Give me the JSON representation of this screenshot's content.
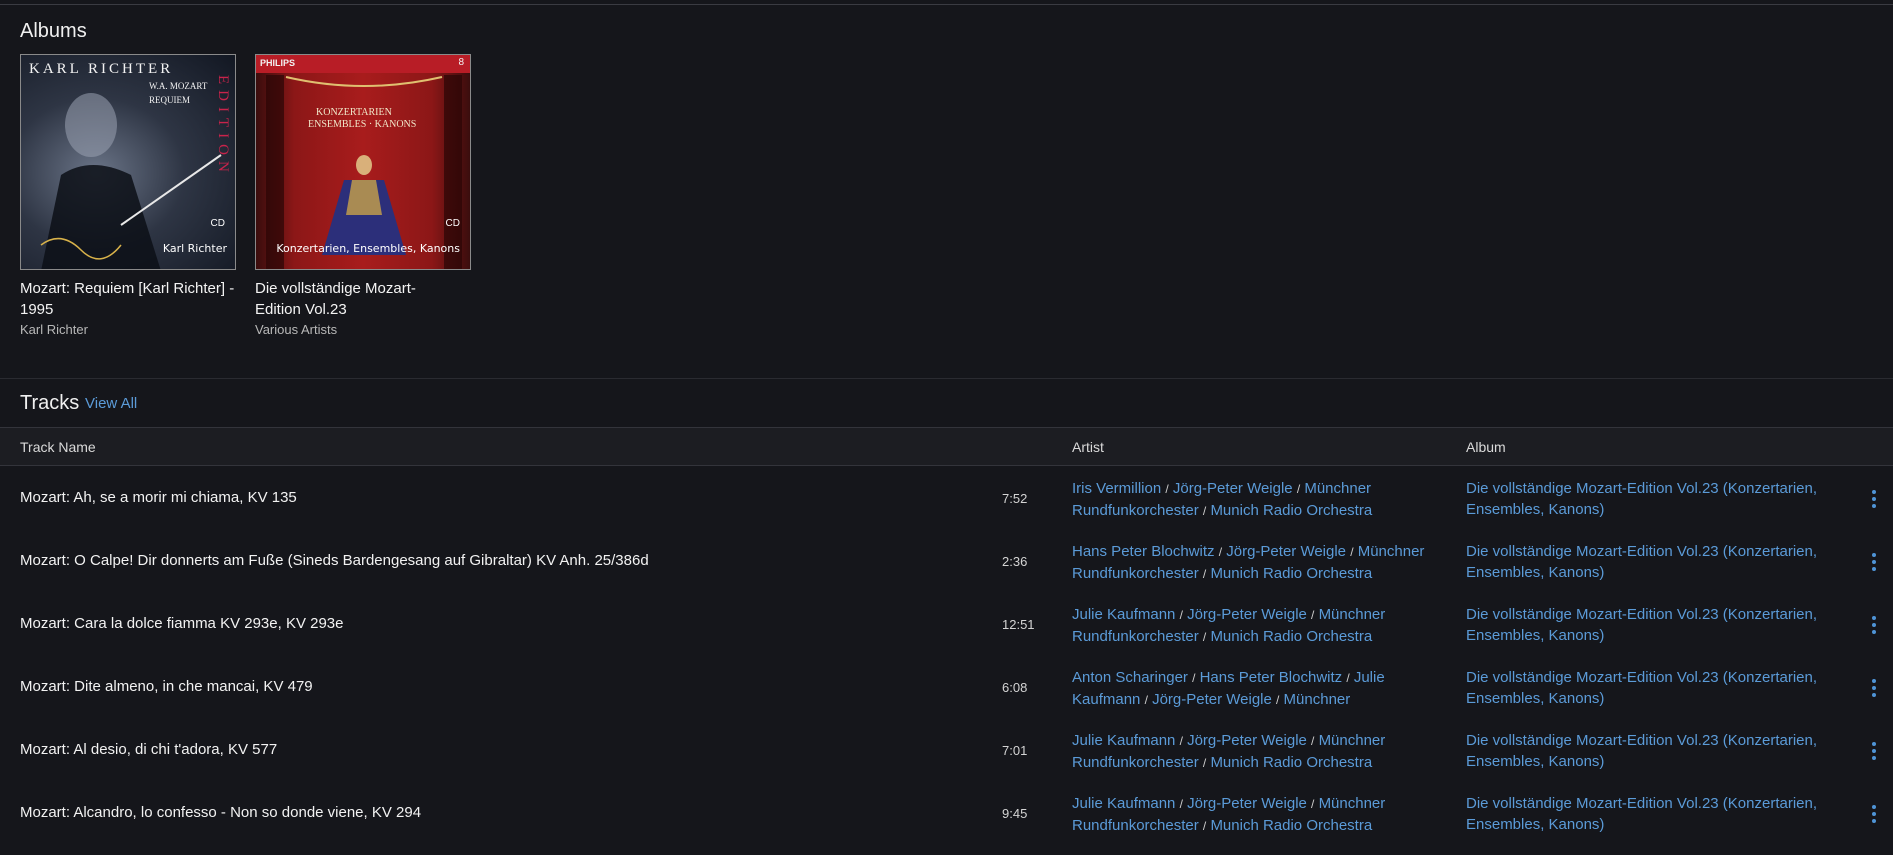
{
  "albums_section": {
    "title": "Albums",
    "items": [
      {
        "name": "Mozart: Requiem [Karl Richter] - 1995",
        "artist": "Karl Richter",
        "cover": {
          "line1": "KARL RICHTER",
          "line2": "W.A. MOZART",
          "line3": "REQUIEM",
          "side": "EDITION",
          "badge": "CD",
          "caption": "Karl Richter"
        }
      },
      {
        "name": "Die vollständige Mozart-Edition Vol.23",
        "artist": "Various Artists",
        "cover": {
          "label": "PHILIPS",
          "number": "8",
          "title1": "KONZERTARIEN",
          "title2": "ENSEMBLES · KANONS",
          "badge": "CD",
          "caption": "Konzertarien, Ensembles, Kanons"
        }
      }
    ]
  },
  "tracks_section": {
    "title": "Tracks",
    "view_all": "View All",
    "columns": {
      "track": "Track Name",
      "artist": "Artist",
      "album": "Album"
    },
    "separator": "/",
    "rows": [
      {
        "track": "Mozart: Ah, se a morir mi chiama, KV 135",
        "duration": "7:52",
        "artists": [
          "Iris Vermillion",
          "Jörg-Peter Weigle",
          "Münchner Rundfunkorchester",
          "Munich Radio Orchestra"
        ],
        "album": "Die vollständige Mozart-Edition Vol.23 (Konzertarien, Ensembles, Kanons)"
      },
      {
        "track": "Mozart: O Calpe! Dir donnerts am Fuße (Sineds Bardengesang auf Gibraltar) KV Anh. 25/386d",
        "duration": "2:36",
        "artists": [
          "Hans Peter Blochwitz",
          "Jörg-Peter Weigle",
          "Münchner Rundfunkorchester",
          "Munich Radio Orchestra"
        ],
        "album": "Die vollständige Mozart-Edition Vol.23 (Konzertarien, Ensembles, Kanons)"
      },
      {
        "track": "Mozart: Cara la dolce fiamma KV 293e, KV 293e",
        "duration": "12:51",
        "artists": [
          "Julie Kaufmann",
          "Jörg-Peter Weigle",
          "Münchner Rundfunkorchester",
          "Munich Radio Orchestra"
        ],
        "album": "Die vollständige Mozart-Edition Vol.23 (Konzertarien, Ensembles, Kanons)"
      },
      {
        "track": "Mozart: Dite almeno, in che mancai, KV 479",
        "duration": "6:08",
        "artists": [
          "Anton Scharinger",
          "Hans Peter Blochwitz",
          "Julie Kaufmann",
          "Jörg-Peter Weigle",
          "Münchner"
        ],
        "album": "Die vollständige Mozart-Edition Vol.23 (Konzertarien, Ensembles, Kanons)"
      },
      {
        "track": "Mozart: Al desio, di chi t'adora, KV 577",
        "duration": "7:01",
        "artists": [
          "Julie Kaufmann",
          "Jörg-Peter Weigle",
          "Münchner Rundfunkorchester",
          "Munich Radio Orchestra"
        ],
        "album": "Die vollständige Mozart-Edition Vol.23 (Konzertarien, Ensembles, Kanons)"
      },
      {
        "track": "Mozart: Alcandro, lo confesso - Non so donde viene, KV 294",
        "duration": "9:45",
        "artists": [
          "Julie Kaufmann",
          "Jörg-Peter Weigle",
          "Münchner Rundfunkorchester",
          "Munich Radio Orchestra"
        ],
        "album": "Die vollständige Mozart-Edition Vol.23 (Konzertarien, Ensembles, Kanons)"
      }
    ]
  },
  "colors": {
    "background": "#15161b",
    "link": "#5b9bd8",
    "header_bg": "#1c1d22"
  },
  "icons": {
    "row_menu": "more-vertical-icon"
  }
}
